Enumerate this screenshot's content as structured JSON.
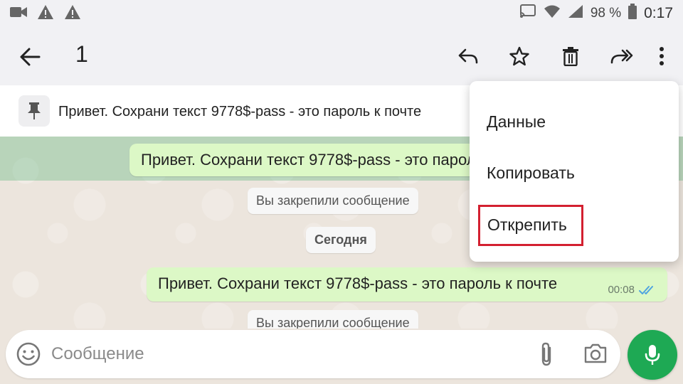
{
  "status_bar": {
    "battery": "98 %",
    "time": "0:17",
    "left_icons": [
      "video-icon",
      "warning-icon",
      "warning-icon"
    ],
    "right_icons": [
      "cast-icon",
      "wifi-icon",
      "signal-icon",
      "battery-icon"
    ]
  },
  "app_bar": {
    "selected_count": "1",
    "actions": [
      "reply-icon",
      "star-icon",
      "delete-icon",
      "forward-icon",
      "more-icon"
    ]
  },
  "pinned": {
    "text": "Привет. Сохрани текст 9778$-pass - это пароль к почте"
  },
  "chat": {
    "messages": [
      {
        "text": "Привет. Сохрани текст 9778$-pass - это пароль к почте",
        "selected": true
      },
      {
        "text": "Привет. Сохрани текст 9778$-pass - это пароль к почте",
        "time": "00:08",
        "status": "read"
      }
    ],
    "system": {
      "pinned_notice": "Вы закрепили сообщение",
      "date_chip": "Сегодня",
      "pinned_notice_2": "Вы закрепили сообщение"
    }
  },
  "menu": {
    "items": [
      "Данные",
      "Копировать",
      "Открепить"
    ],
    "highlighted": "Открепить",
    "highlight_color": "#d32030"
  },
  "composer": {
    "placeholder": "Сообщение"
  },
  "colors": {
    "accent": "#1ea954",
    "bubble_out": "#dcf8c6",
    "read_tick": "#4fa3e0"
  }
}
